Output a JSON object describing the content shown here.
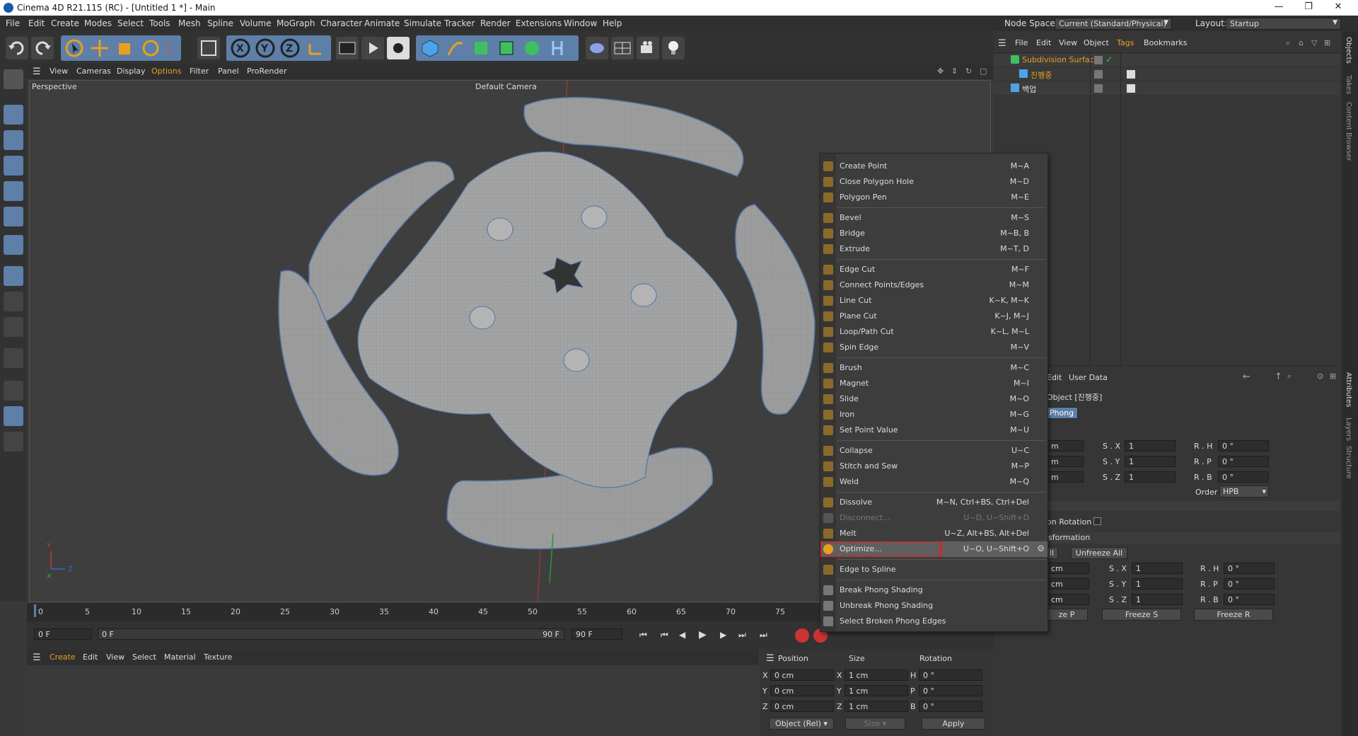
{
  "titlebar": {
    "title": "Cinema 4D R21.115 (RC) - [Untitled 1 *] - Main",
    "min": "—",
    "max": "❐",
    "close": "✕"
  },
  "menubar": [
    "File",
    "Edit",
    "Create",
    "Modes",
    "Select",
    "Tools",
    "Mesh",
    "Spline",
    "Volume",
    "MoGraph",
    "Character",
    "Animate",
    "Simulate",
    "Tracker",
    "Render",
    "Extensions",
    "Window",
    "Help"
  ],
  "nodespace": {
    "label": "Node Space:",
    "value": "Current (Standard/Physical)"
  },
  "layout": {
    "label": "Layout:",
    "value": "Startup"
  },
  "viewport_menu": [
    "View",
    "Cameras",
    "Display",
    "Options",
    "Filter",
    "Panel",
    "ProRender"
  ],
  "viewport": {
    "name": "Perspective",
    "camera": "Default Camera"
  },
  "object_menu": [
    "File",
    "Edit",
    "View",
    "Object",
    "Tags",
    "Bookmarks"
  ],
  "objects": [
    {
      "name": "Subdivision Surface"
    },
    {
      "name": "진행중"
    },
    {
      "name": "백업"
    }
  ],
  "attributes": {
    "menu": [
      "Edit",
      "User Data"
    ],
    "object_title": "Object [진행중]",
    "tab": "Phong",
    "scale_labels": [
      "S . X",
      "S . Y",
      "S . Z"
    ],
    "scale_values": [
      "1",
      "1",
      "1"
    ],
    "rot_labels": [
      "R . H",
      "R . P",
      "R . B"
    ],
    "rot_values": [
      "0 °",
      "0 °",
      "0 °"
    ],
    "pos_values": [
      "m",
      "m",
      "m"
    ],
    "order_label": "Order",
    "order_value": "HPB",
    "rotation_label": "on Rotation",
    "freeze_section": "sformation",
    "all_btn": "ll",
    "unfreeze_btn": "Unfreeze All",
    "freeze_pos_values": [
      "cm",
      "cm",
      "cm"
    ],
    "freeze_scale_values": [
      "1",
      "1",
      "1"
    ],
    "freeze_rot_values": [
      "0 °",
      "0 °",
      "0 °"
    ],
    "freeze_p": "ze P",
    "freeze_s": "Freeze S",
    "freeze_r": "Freeze R"
  },
  "context_menu": [
    {
      "label": "Create Point",
      "shortcut": "M~A"
    },
    {
      "label": "Close Polygon Hole",
      "shortcut": "M~D"
    },
    {
      "label": "Polygon Pen",
      "shortcut": "M~E"
    },
    {
      "sep": true
    },
    {
      "label": "Bevel",
      "shortcut": "M~S"
    },
    {
      "label": "Bridge",
      "shortcut": "M~B, B"
    },
    {
      "label": "Extrude",
      "shortcut": "M~T, D"
    },
    {
      "sep": true
    },
    {
      "label": "Edge Cut",
      "shortcut": "M~F"
    },
    {
      "label": "Connect Points/Edges",
      "shortcut": "M~M"
    },
    {
      "label": "Line Cut",
      "shortcut": "K~K, M~K"
    },
    {
      "label": "Plane Cut",
      "shortcut": "K~J, M~J"
    },
    {
      "label": "Loop/Path Cut",
      "shortcut": "K~L, M~L"
    },
    {
      "label": "Spin Edge",
      "shortcut": "M~V"
    },
    {
      "sep": true
    },
    {
      "label": "Brush",
      "shortcut": "M~C"
    },
    {
      "label": "Magnet",
      "shortcut": "M~I"
    },
    {
      "label": "Slide",
      "shortcut": "M~O"
    },
    {
      "label": "Iron",
      "shortcut": "M~G"
    },
    {
      "label": "Set Point Value",
      "shortcut": "M~U"
    },
    {
      "sep": true
    },
    {
      "label": "Collapse",
      "shortcut": "U~C"
    },
    {
      "label": "Stitch and Sew",
      "shortcut": "M~P"
    },
    {
      "label": "Weld",
      "shortcut": "M~Q"
    },
    {
      "sep": true
    },
    {
      "label": "Dissolve",
      "shortcut": "M~N, Ctrl+BS, Ctrl+Del"
    },
    {
      "label": "Disconnect...",
      "shortcut": "U~D, U~Shift+D",
      "disabled": true
    },
    {
      "label": "Melt",
      "shortcut": "U~Z, Alt+BS, Alt+Del"
    },
    {
      "label": "Optimize...",
      "shortcut": "U~O, U~Shift+O",
      "highlight": true
    },
    {
      "sep": true
    },
    {
      "label": "Edge to Spline",
      "shortcut": ""
    },
    {
      "sep": true
    },
    {
      "label": "Break Phong Shading",
      "shortcut": ""
    },
    {
      "label": "Unbreak Phong Shading",
      "shortcut": ""
    },
    {
      "label": "Select Broken Phong Edges",
      "shortcut": ""
    }
  ],
  "timeline": {
    "ticks": [
      "0",
      "5",
      "10",
      "15",
      "20",
      "25",
      "30",
      "35",
      "40",
      "45",
      "50",
      "55",
      "60",
      "65",
      "70",
      "75"
    ]
  },
  "frames": {
    "start": "0 F",
    "current": "0 F",
    "end_field": "90 F",
    "end": "90 F"
  },
  "material_menu": [
    "Create",
    "Edit",
    "View",
    "Select",
    "Material",
    "Texture"
  ],
  "coords": {
    "headers": [
      "Position",
      "Size",
      "Rotation"
    ],
    "axes": [
      "X",
      "Y",
      "Z"
    ],
    "size_axes": [
      "X",
      "Y",
      "Z"
    ],
    "rot_axes": [
      "H",
      "P",
      "B"
    ],
    "position": [
      "0 cm",
      "0 cm",
      "0 cm"
    ],
    "size": [
      "1 cm",
      "1 cm",
      "1 cm"
    ],
    "rotation": [
      "0 °",
      "0 °",
      "0 °"
    ],
    "mode": "Object (Rel)",
    "size_mode": "Size",
    "apply": "Apply"
  },
  "side_tabs": [
    "Objects",
    "Takes",
    "Content Browser",
    "Attributes",
    "Layers",
    "Structure"
  ]
}
